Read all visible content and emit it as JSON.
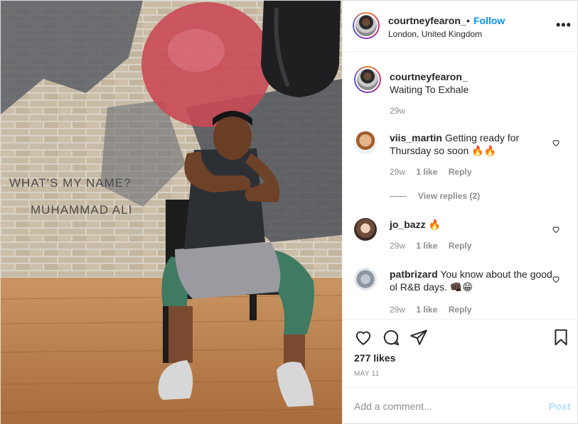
{
  "header": {
    "username": "courtneyfearon_",
    "dot": "•",
    "follow_label": "Follow",
    "location": "London, United Kingdom",
    "more_label": "•••"
  },
  "photo": {
    "wall_text_1": "WHAT'S MY NAME?",
    "wall_text_2": "MUHAMMAD ALI"
  },
  "caption": {
    "username": "courtneyfearon_",
    "text": "Waiting To Exhale",
    "time": "29w"
  },
  "comments": [
    {
      "username": "viis_martin",
      "text": "Getting ready for Thursday so soon 🔥🔥",
      "time": "29w",
      "likes": "1 like",
      "reply": "Reply"
    },
    {
      "username": "jo_bazz",
      "text": "🔥",
      "time": "29w",
      "likes": "1 like",
      "reply": "Reply"
    },
    {
      "username": "patbrizard",
      "text": "You know about the good ol R&B days. 👊🏿😁",
      "time": "29w",
      "likes": "1 like",
      "reply": "Reply"
    }
  ],
  "view_replies": "View replies (2)",
  "post": {
    "likes": "277 likes",
    "date": "MAY 11"
  },
  "add_comment": {
    "placeholder": "Add a comment...",
    "post_label": "Post"
  },
  "colors": {
    "accent": "#0095f6",
    "post_disabled": "#b2dffc",
    "muted": "#8e8e8e",
    "text": "#262626"
  }
}
